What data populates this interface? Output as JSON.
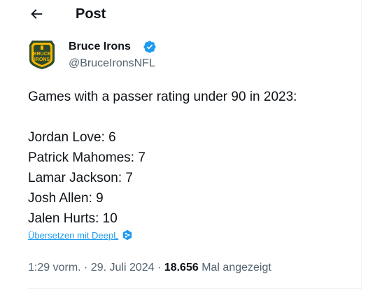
{
  "header": {
    "title": "Post",
    "back_icon": "arrow-left-icon"
  },
  "author": {
    "display_name": "Bruce Irons",
    "handle": "@BruceIronsNFL",
    "verified": true,
    "verified_icon": "verified-badge-icon",
    "avatar_text": [
      "BRUCE",
      "IRONS"
    ]
  },
  "tweet": {
    "lines": [
      "Games with a passer rating under 90 in 2023:",
      "",
      "Jordan Love: 6",
      "Patrick Mahomes: 7",
      "Lamar Jackson: 7",
      "Josh Allen: 9",
      "Jalen Hurts: 10"
    ]
  },
  "translate": {
    "label": "Übersetzen mit DeepL",
    "icon": "deepl-icon"
  },
  "meta": {
    "time": "1:29 vorm.",
    "separator": "·",
    "date": "29. Juli 2024",
    "views_count": "18.656",
    "views_label": "Mal angezeigt"
  },
  "colors": {
    "text_primary": "#0f1419",
    "text_secondary": "#536471",
    "link": "#1d9bf0",
    "verified": "#1d9bf0",
    "avatar_bg": "#2f4a2b",
    "avatar_accent": "#f2b705",
    "divider": "#eff3f4"
  }
}
